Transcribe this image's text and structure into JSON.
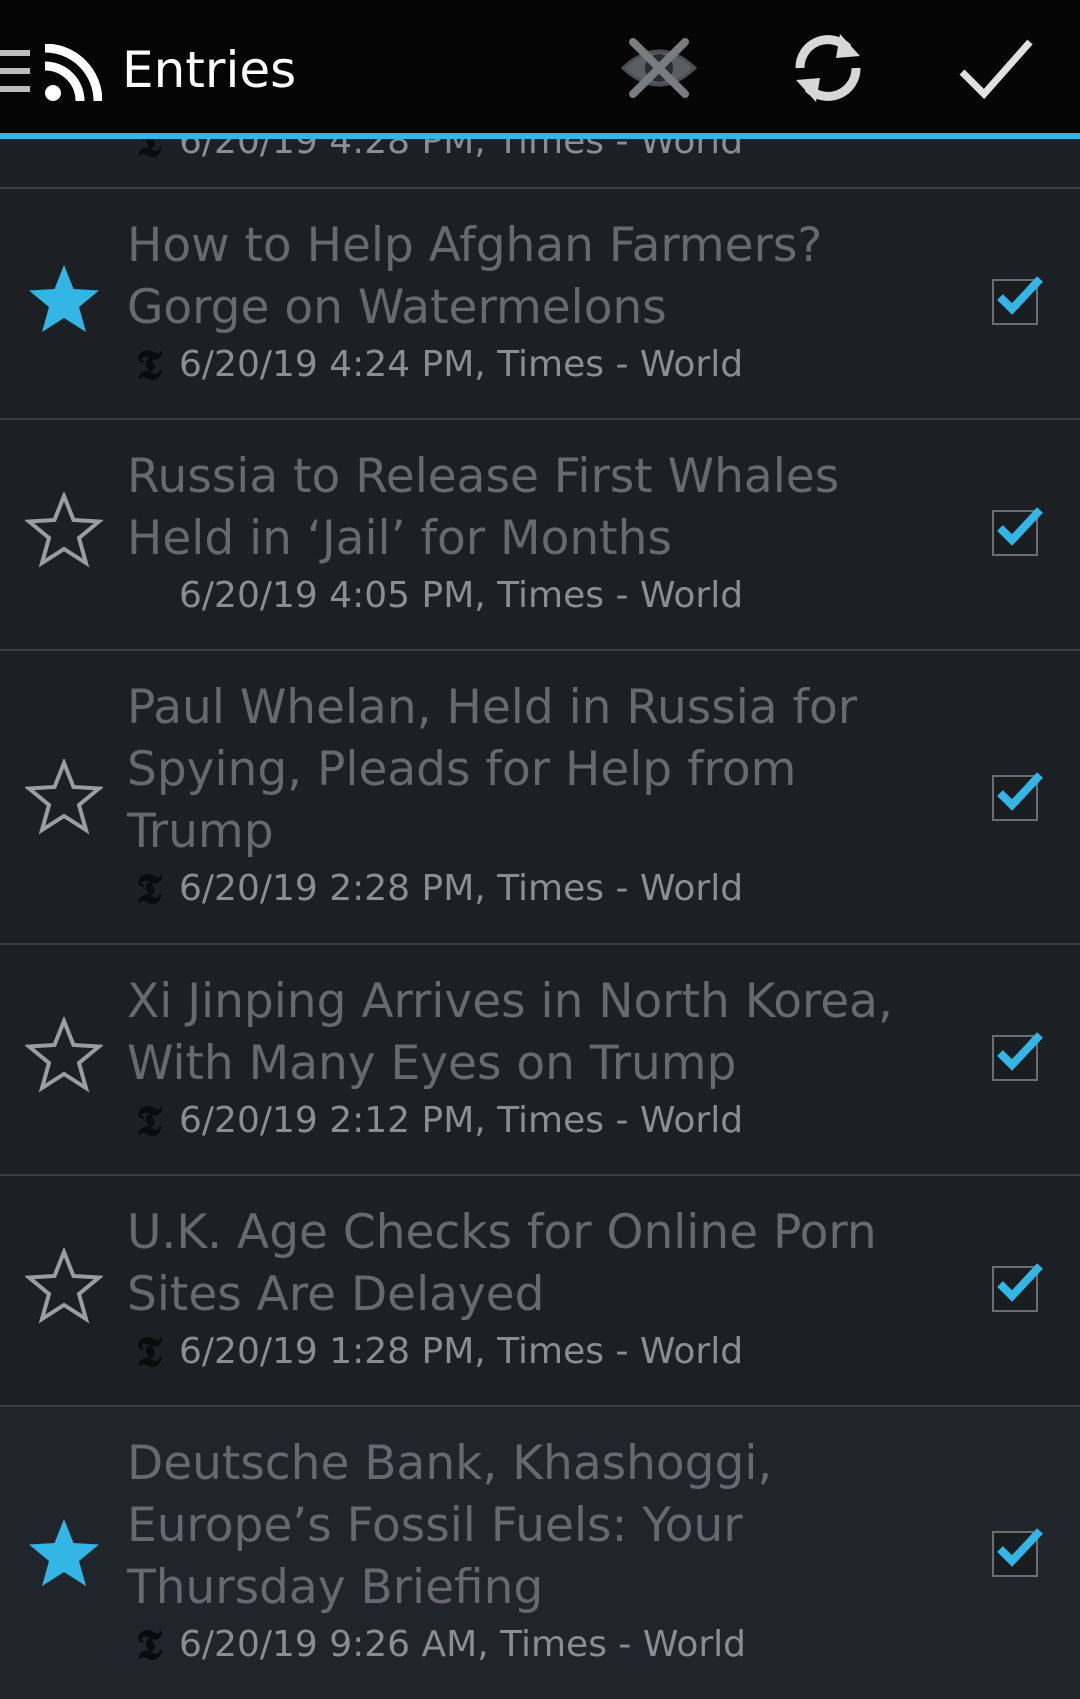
{
  "toolbar": {
    "title": "Entries",
    "accent_color": "#33b5e5",
    "icons": [
      "menu-icon",
      "rss-icon",
      "hide-read-icon",
      "refresh-icon",
      "mark-all-read-icon"
    ]
  },
  "partial_entry": {
    "date": "6/20/19 4:28 PM",
    "feed": "Times - World"
  },
  "entries": [
    {
      "title": "How to Help Afghan Farmers? Gorge on Watermelons",
      "date": "6/20/19 4:24 PM",
      "feed": "Times - World",
      "starred": true,
      "checked": true
    },
    {
      "title": "Russia to Release First Whales Held in ‘Jail’ for Months",
      "date": "6/20/19 4:05 PM",
      "feed": "Times - World",
      "starred": false,
      "checked": true
    },
    {
      "title": "Paul Whelan, Held in Russia for Spying, Pleads for Help from Trump",
      "date": "6/20/19 2:28 PM",
      "feed": "Times - World",
      "starred": false,
      "checked": true
    },
    {
      "title": "Xi Jinping Arrives in North Korea, With Many Eyes on Trump",
      "date": "6/20/19 2:12 PM",
      "feed": "Times - World",
      "starred": false,
      "checked": true
    },
    {
      "title": "U.K. Age Checks for Online Porn Sites Are Delayed",
      "date": "6/20/19 1:28 PM",
      "feed": "Times - World",
      "starred": false,
      "checked": true
    },
    {
      "title": "Deutsche Bank, Khashoggi, Europe’s Fossil Fuels: Your Thursday Briefing",
      "date": "6/20/19 9:26 AM",
      "feed": "Times - World",
      "starred": true,
      "checked": true
    }
  ]
}
